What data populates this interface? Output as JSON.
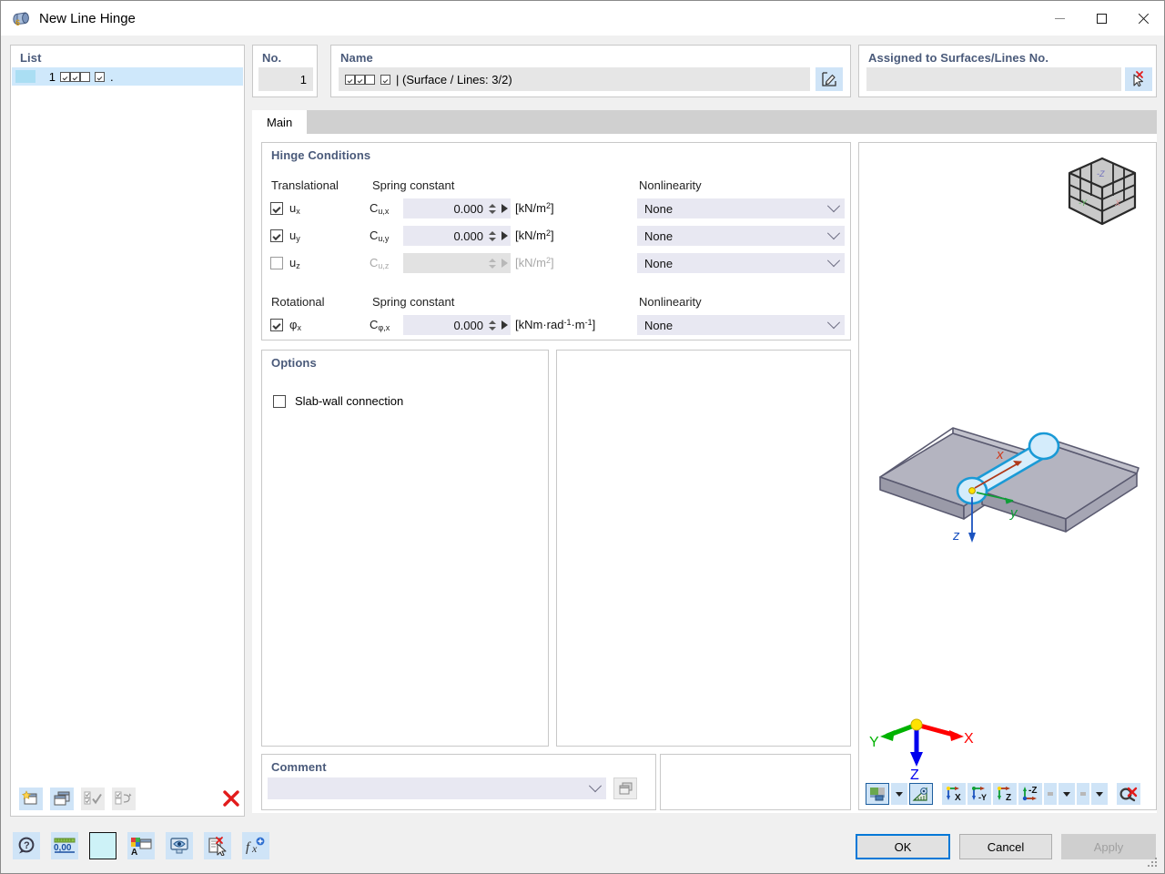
{
  "window": {
    "title": "New Line Hinge",
    "icon": "line-hinge-icon",
    "minimize": "–",
    "maximize": "□",
    "close": "✕"
  },
  "list": {
    "title": "List",
    "rows": [
      {
        "number": "1",
        "checks": [
          true,
          true,
          false,
          true
        ],
        "trailing": "."
      }
    ],
    "toolbar": [
      {
        "name": "new-hinge-button",
        "enabled": true
      },
      {
        "name": "copy-hinge-button",
        "enabled": true
      },
      {
        "name": "select-all-button",
        "enabled": false
      },
      {
        "name": "invert-selection-button",
        "enabled": false
      },
      {
        "name": "delete-hinge-button",
        "enabled": true
      }
    ]
  },
  "no_panel": {
    "title": "No.",
    "value": "1"
  },
  "name_panel": {
    "title": "Name",
    "checks": [
      true,
      true,
      false,
      true
    ],
    "value": "| (Surface / Lines: 3/2)",
    "edit_button": "edit-name-button"
  },
  "assigned_panel": {
    "title": "Assigned to Surfaces/Lines No.",
    "value": "",
    "pick_button": "pick-surfaces-lines-button"
  },
  "tabs": [
    {
      "label": "Main",
      "active": true
    }
  ],
  "hinge_conditions": {
    "title": "Hinge Conditions",
    "headers": {
      "translational": "Translational",
      "rotational": "Rotational",
      "spring_constant": "Spring constant",
      "nonlinearity": "Nonlinearity"
    },
    "translational_rows": [
      {
        "dof": "u",
        "dof_sub": "x",
        "checked": true,
        "enabled": true,
        "symbol": "C",
        "symbol_sub": "u,x",
        "value": "0.000",
        "unit_pre": "[kN/m",
        "unit_sup": "2",
        "unit_post": "]",
        "nonlinearity": "None"
      },
      {
        "dof": "u",
        "dof_sub": "y",
        "checked": true,
        "enabled": true,
        "symbol": "C",
        "symbol_sub": "u,y",
        "value": "0.000",
        "unit_pre": "[kN/m",
        "unit_sup": "2",
        "unit_post": "]",
        "nonlinearity": "None"
      },
      {
        "dof": "u",
        "dof_sub": "z",
        "checked": false,
        "enabled": false,
        "symbol": "C",
        "symbol_sub": "u,z",
        "value": "",
        "unit_pre": "[kN/m",
        "unit_sup": "2",
        "unit_post": "]",
        "nonlinearity": "None"
      }
    ],
    "rotational_rows": [
      {
        "dof": "φ",
        "dof_sub": "x",
        "checked": true,
        "enabled": true,
        "symbol": "C",
        "symbol_sub": "φ,x",
        "value": "0.000",
        "unit": "[kNm·rad-1·m-1]",
        "nonlinearity": "None"
      }
    ]
  },
  "options": {
    "title": "Options",
    "slab_wall_label": "Slab-wall connection",
    "slab_wall_checked": false
  },
  "comment": {
    "title": "Comment",
    "value": "",
    "library_button": "comment-library-button"
  },
  "view": {
    "nav_cube": "view-cube-icon",
    "axes": {
      "x": "X",
      "y": "Y",
      "z": "Z"
    },
    "model_axes": {
      "x": "x",
      "y": "y",
      "z": "z"
    },
    "toolbar": [
      {
        "name": "render-mode-button",
        "label": ""
      },
      {
        "name": "render-mode-dropdown",
        "label": ""
      },
      {
        "name": "measure-button",
        "label": ""
      },
      {
        "name": "view-x-button",
        "label": "X"
      },
      {
        "name": "view-neg-y-button",
        "label": "-Y"
      },
      {
        "name": "view-z-button",
        "label": "Z"
      },
      {
        "name": "view-iso-z-button",
        "label": "-Z"
      },
      {
        "name": "view-options-dropdown",
        "label": ""
      },
      {
        "name": "display-options-dropdown",
        "label": ""
      },
      {
        "name": "reset-view-button",
        "label": ""
      }
    ]
  },
  "bottom_toolbar": [
    {
      "name": "help-button"
    },
    {
      "name": "units-decimal-places-button"
    },
    {
      "name": "color-swatch-button"
    },
    {
      "name": "display-properties-button"
    },
    {
      "name": "visibility-button"
    },
    {
      "name": "clear-selection-button"
    },
    {
      "name": "formula-button"
    }
  ],
  "dialog_buttons": {
    "ok": "OK",
    "cancel": "Cancel",
    "apply": "Apply",
    "apply_enabled": false
  },
  "colors": {
    "accent": "#0078d7",
    "group_title": "#4a5a7a",
    "field": "#e8e8f2",
    "list_selection": "#cfe8fb",
    "swatch": "#aadef3",
    "axis_x": "#ff0000",
    "axis_y": "#00b200",
    "axis_z": "#0000ee",
    "delete_red": "#e21b1b"
  }
}
